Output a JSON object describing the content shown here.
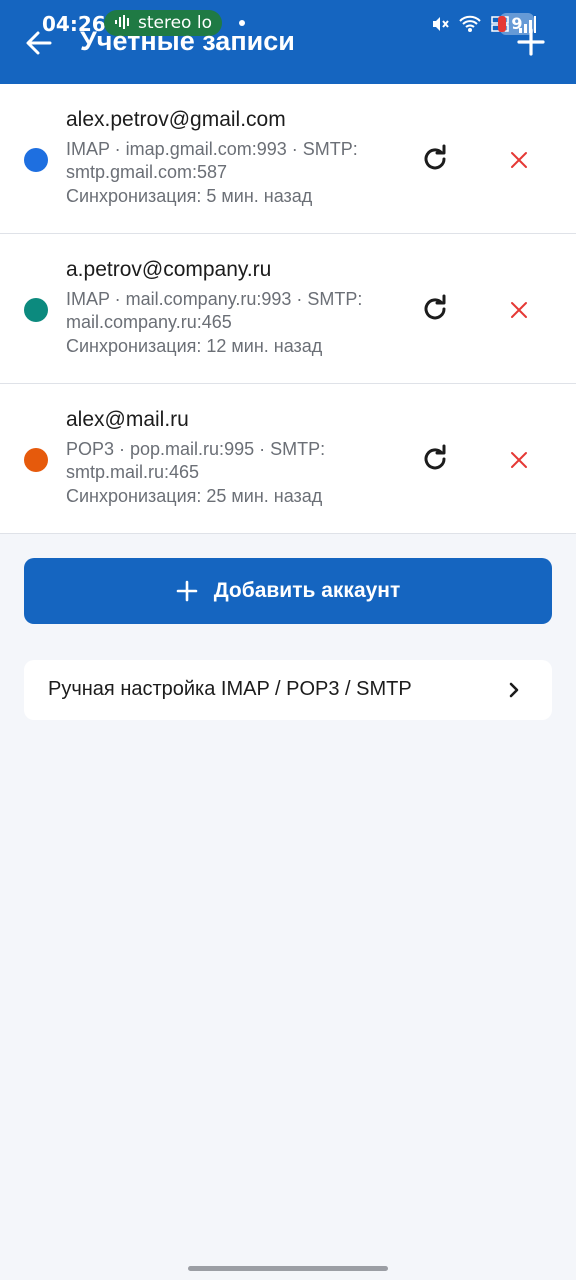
{
  "status_bar": {
    "time": "04:26",
    "media_pill": "stereo lo",
    "battery_level": "9"
  },
  "header": {
    "title": "Учетные записи",
    "bg_color": "#1565c0"
  },
  "accounts": [
    {
      "email": "alex.petrov@gmail.com",
      "server": "IMAP · imap.gmail.com:993 · SMTP: smtp.gmail.com:587",
      "sync": "Синхронизация: 5 мин. назад",
      "color": "#1e6fe0"
    },
    {
      "email": "a.petrov@company.ru",
      "server": "IMAP · mail.company.ru:993 · SMTP: mail.company.ru:465",
      "sync": "Синхронизация: 12 мин. назад",
      "color": "#0c8a7e"
    },
    {
      "email": "alex@mail.ru",
      "server": "POP3 · pop.mail.ru:995 · SMTP: smtp.mail.ru:465",
      "sync": "Синхронизация: 25 мин. назад",
      "color": "#e65a0c"
    }
  ],
  "actions": {
    "add_account_label": "Добавить аккаунт",
    "manual_setup_label": "Ручная настройка IMAP / POP3 / SMTP"
  },
  "icons": {
    "back": "arrow-left-icon",
    "add": "plus-icon",
    "refresh": "refresh-icon",
    "remove": "close-icon",
    "chevron": "chevron-right-icon"
  },
  "colors": {
    "remove_icon": "#e53935",
    "background": "#f4f6fa"
  }
}
